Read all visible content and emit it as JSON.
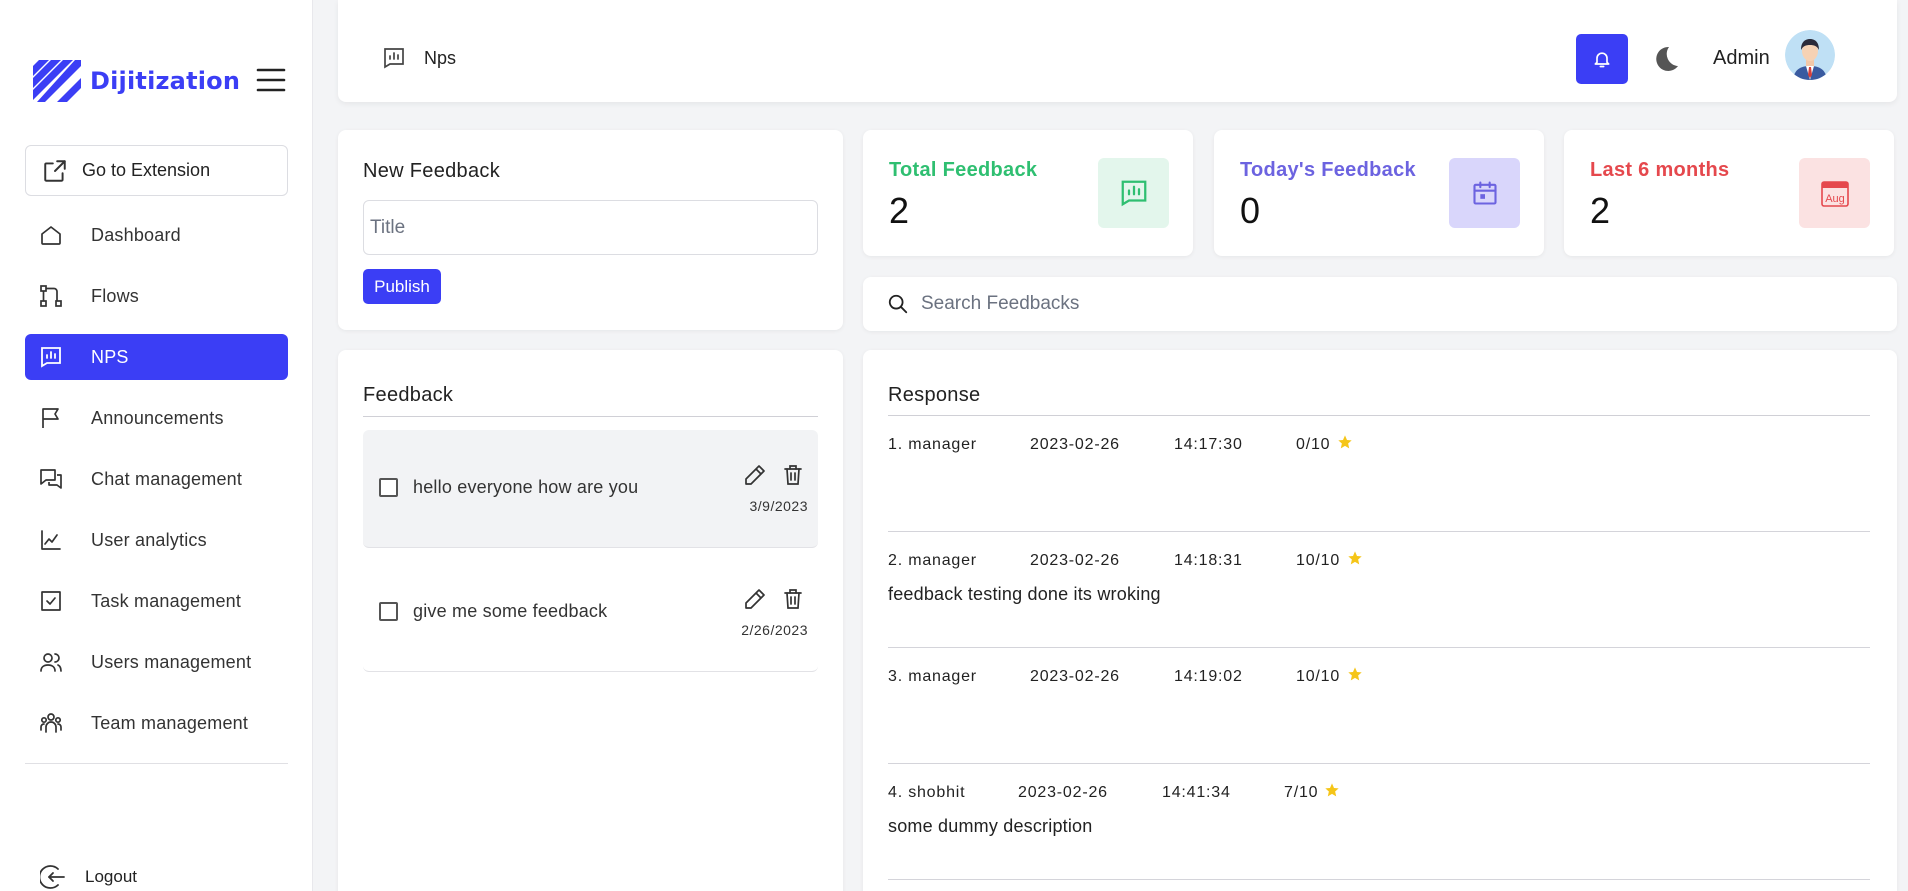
{
  "brand": {
    "name": "Dijitization"
  },
  "sidebar": {
    "extension_label": "Go to Extension",
    "items": [
      {
        "label": "Dashboard",
        "icon": "home-icon"
      },
      {
        "label": "Flows",
        "icon": "flow-icon"
      },
      {
        "label": "NPS",
        "icon": "chart-icon",
        "active": true
      },
      {
        "label": "Announcements",
        "icon": "flag-icon"
      },
      {
        "label": "Chat management",
        "icon": "chat-icon"
      },
      {
        "label": "User analytics",
        "icon": "analytics-icon"
      },
      {
        "label": "Task management",
        "icon": "task-icon"
      },
      {
        "label": "Users management",
        "icon": "users-icon"
      },
      {
        "label": "Team management",
        "icon": "team-icon"
      }
    ],
    "logout_label": "Logout"
  },
  "header": {
    "page_title": "Nps",
    "user_name": "Admin"
  },
  "new_feedback": {
    "title": "New Feedback",
    "placeholder": "Title",
    "publish_label": "Publish"
  },
  "stats": [
    {
      "label": "Total Feedback",
      "value": "2",
      "color": "#2fbf71",
      "bg": "#e3f6ec",
      "icon": "chart-icon"
    },
    {
      "label": "Today's Feedback",
      "value": "0",
      "color": "#6c63e0",
      "bg": "#d9d6fb",
      "icon": "calendar-icon"
    },
    {
      "label": "Last 6 months",
      "value": "2",
      "color": "#e5484d",
      "bg": "#fbe2e2",
      "icon": "calendar-aug-icon",
      "icon_text": "Aug"
    }
  ],
  "search": {
    "placeholder": "Search Feedbacks"
  },
  "feedback": {
    "title": "Feedback",
    "items": [
      {
        "text": "hello everyone how are you",
        "date": "3/9/2023"
      },
      {
        "text": "give me some feedback",
        "date": "2/26/2023"
      }
    ]
  },
  "responses": {
    "title": "Response",
    "items": [
      {
        "name": "1. manager",
        "date": "2023-02-26",
        "time": "14:17:30",
        "score": "0/10",
        "description": ""
      },
      {
        "name": "2. manager",
        "date": "2023-02-26",
        "time": "14:18:31",
        "score": "10/10",
        "description": "feedback testing done its wroking"
      },
      {
        "name": "3. manager",
        "date": "2023-02-26",
        "time": "14:19:02",
        "score": "10/10",
        "description": ""
      },
      {
        "name": "4. shobhit",
        "date": "2023-02-26",
        "time": "14:41:34",
        "score": "7/10",
        "description": "some dummy description"
      }
    ]
  },
  "colors": {
    "accent": "#3b3ef5",
    "star": "#f5c518"
  }
}
